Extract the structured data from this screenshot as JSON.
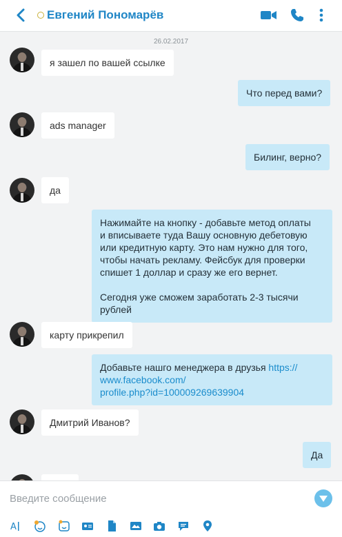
{
  "header": {
    "title": "Евгений Пономарёв",
    "icons": [
      "back-arrow-icon",
      "status-icon",
      "video-call-icon",
      "phone-call-icon",
      "more-vertical-icon"
    ],
    "accent_color": "#1f86c6"
  },
  "chat": {
    "date": "26.02.2017",
    "messages": [
      {
        "from": "contact",
        "text": "я зашел по вашей ссылке"
      },
      {
        "from": "me",
        "text": "Что перед вами?"
      },
      {
        "from": "contact",
        "text": "ads manager"
      },
      {
        "from": "me",
        "text": "Билинг, верно?"
      },
      {
        "from": "contact",
        "text": "да"
      },
      {
        "from": "me",
        "lines": [
          "Нажимайте на кнопку - добавьте метод оплаты",
          "и вписываете туда Вашу основную дебетовую",
          "или кредитную карту. Это нам нужно для того,",
          "чтобы начать рекламу. Фейсбук для проверки",
          "спишет 1 доллар и сразу же его вернет."
        ],
        "lines2": [
          "Сегодня уже сможем заработать 2-3 тысячи",
          "рублей"
        ]
      },
      {
        "from": "contact",
        "text": "карту прикрепил"
      },
      {
        "from": "me",
        "text_prefix": "Добавьте нашго менеджера в друзья ",
        "link_lines": [
          "https://",
          "www.facebook.com/",
          "profile.php?id=100009269639904"
        ]
      },
      {
        "from": "contact",
        "text": "Дмитрий Иванов?"
      },
      {
        "from": "me",
        "text": "Да"
      },
      {
        "from": "contact",
        "text": ""
      }
    ],
    "bubble_colors": {
      "incoming": "#ffffff",
      "outgoing": "#c8e9f8"
    }
  },
  "composer": {
    "placeholder": "Введите сообщение",
    "send_icon": "send-icon",
    "tools": [
      "text-format-icon",
      "emoticon-icon",
      "moji-icon",
      "contact-card-icon",
      "file-icon",
      "media-bar-icon",
      "video-message-icon",
      "camera-icon",
      "chat-bubble-icon",
      "location-icon"
    ]
  }
}
